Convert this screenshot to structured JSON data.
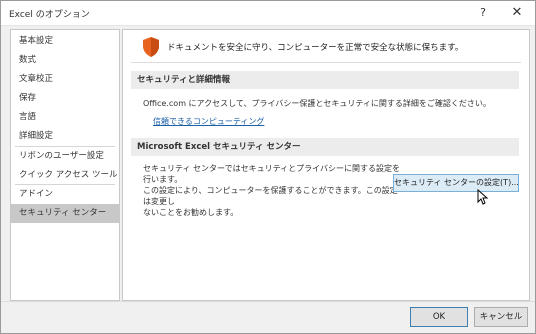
{
  "window": {
    "title": "Excel のオプション",
    "help_glyph": "?",
    "close_glyph": "✕"
  },
  "sidebar": {
    "items": [
      {
        "label": "基本設定"
      },
      {
        "label": "数式"
      },
      {
        "label": "文章校正"
      },
      {
        "label": "保存"
      },
      {
        "label": "言語"
      },
      {
        "label": "詳細設定"
      },
      {
        "label": "リボンのユーザー設定"
      },
      {
        "label": "クイック アクセス ツール バー"
      },
      {
        "label": "アドイン"
      },
      {
        "label": "セキュリティ センター"
      }
    ],
    "selected": "セキュリティ センター"
  },
  "content": {
    "intro": "ドキュメントを安全に守り、コンピューターを正常で安全な状態に保ちます。",
    "privacy_section": {
      "header": "セキュリティと詳細情報",
      "text": "Office.com にアクセスして、プライバシー保護とセキュリティに関する詳細をご確認ください。",
      "link": "信頼できるコンピューティング"
    },
    "trust_section": {
      "header": "Microsoft Excel セキュリティ センター",
      "desc_line1": "セキュリティ センターではセキュリティとプライバシーに関する設定を行います。",
      "desc_line2": "この設定により、コンピューターを保護することができます。この設定は変更し",
      "desc_line3": "ないことをお勧めします。",
      "button": "セキュリティ センターの設定(T)..."
    }
  },
  "footer": {
    "ok": "OK",
    "cancel": "キャンセル"
  },
  "colors": {
    "shield": "#e8631f",
    "link": "#1a5fa8",
    "selected_bg": "#c8c8c8",
    "button_highlight": "#dcecf7"
  }
}
